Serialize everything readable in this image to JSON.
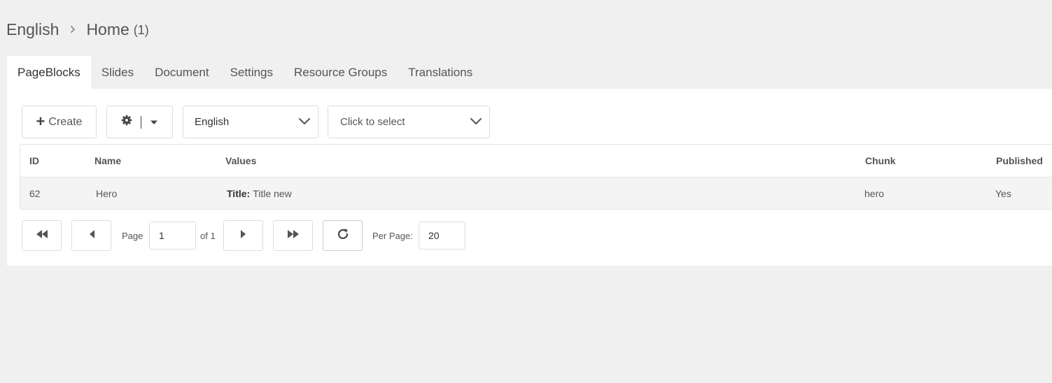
{
  "breadcrumb": {
    "parent": "English",
    "current": "Home",
    "count": "(1)"
  },
  "tabs": [
    {
      "label": "PageBlocks",
      "active": true
    },
    {
      "label": "Slides",
      "active": false
    },
    {
      "label": "Document",
      "active": false
    },
    {
      "label": "Settings",
      "active": false
    },
    {
      "label": "Resource Groups",
      "active": false
    },
    {
      "label": "Translations",
      "active": false
    }
  ],
  "toolbar": {
    "create_label": "Create",
    "language_value": "English",
    "select_placeholder": "Click to select"
  },
  "grid": {
    "columns": [
      "ID",
      "Name",
      "Values",
      "Chunk",
      "Published"
    ],
    "rows": [
      {
        "id": "62",
        "name": "Hero",
        "values_label": "Title:",
        "values_text": "Title new",
        "chunk": "hero",
        "published": "Yes"
      }
    ]
  },
  "pagination": {
    "page_label": "Page",
    "page_value": "1",
    "of_label": "of 1",
    "per_page_label": "Per Page:",
    "per_page_value": "20"
  },
  "colors": {
    "background": "#f0f0f0",
    "panel": "#ffffff",
    "row_background": "#f4f4f4",
    "border": "#dddddd",
    "text": "#555555"
  },
  "icons": {
    "breadcrumb_separator": "chevron-right-icon",
    "create": "plus-icon",
    "settings": "gear-icon",
    "dropdown": "caret-down-icon",
    "select_toggle": "chevron-down-icon",
    "first_page": "double-left-icon",
    "prev_page": "caret-left-icon",
    "next_page": "caret-right-icon",
    "last_page": "double-right-icon",
    "refresh": "refresh-icon"
  }
}
